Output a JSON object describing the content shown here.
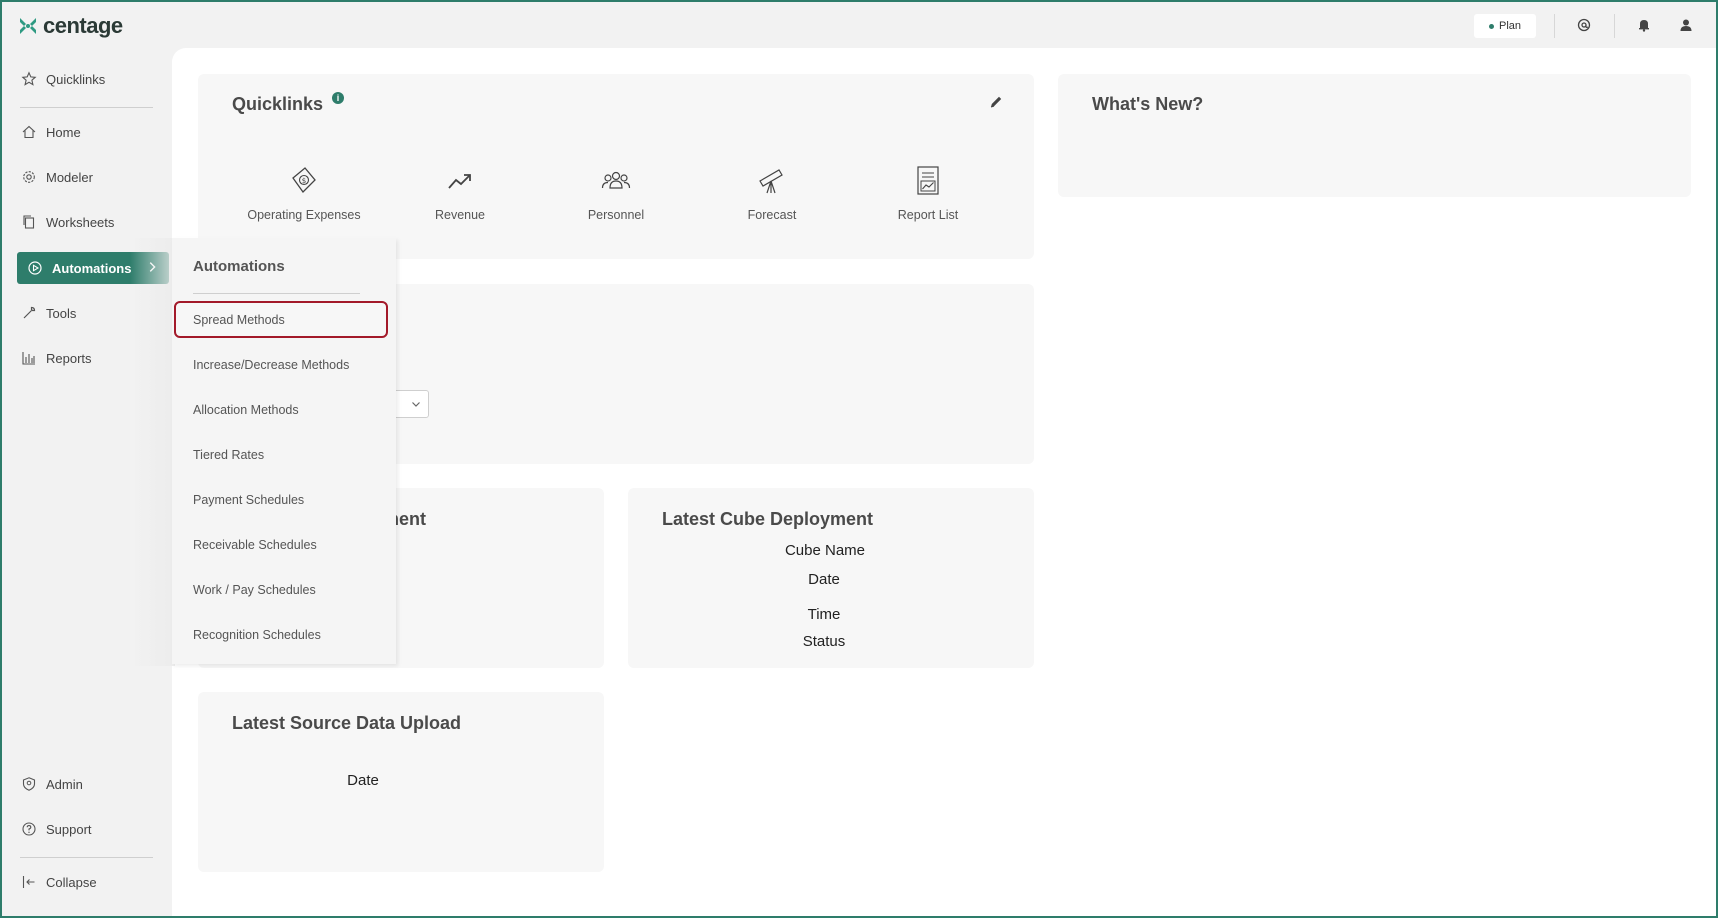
{
  "app": {
    "brand": "centage",
    "plan_label": "Plan",
    "brand_color": "#2e7d6b",
    "highlight_color": "#a31a2a"
  },
  "sidebar": {
    "items": [
      {
        "label": "Quicklinks",
        "icon": "star-icon"
      },
      {
        "label": "Home",
        "icon": "home-icon"
      },
      {
        "label": "Modeler",
        "icon": "gear-icon"
      },
      {
        "label": "Worksheets",
        "icon": "copy-icon"
      },
      {
        "label": "Automations",
        "icon": "play-circle-icon"
      },
      {
        "label": "Tools",
        "icon": "wrench-icon"
      },
      {
        "label": "Reports",
        "icon": "bar-chart-icon"
      }
    ],
    "bottom_items": [
      {
        "label": "Admin",
        "icon": "shield-icon"
      },
      {
        "label": "Support",
        "icon": "help-icon"
      },
      {
        "label": "Collapse",
        "icon": "collapse-icon"
      }
    ]
  },
  "quicklinks": {
    "title": "Quicklinks",
    "items": [
      {
        "label": "Operating Expenses",
        "icon": "money-icon"
      },
      {
        "label": "Revenue",
        "icon": "trend-up-icon"
      },
      {
        "label": "Personnel",
        "icon": "people-icon"
      },
      {
        "label": "Forecast",
        "icon": "telescope-icon"
      },
      {
        "label": "Report List",
        "icon": "report-icon"
      }
    ]
  },
  "whats_new": {
    "title": "What's New?"
  },
  "deployment": {
    "title_partial": "ment",
    "value_partial": "e"
  },
  "cube_deployment": {
    "title": "Latest Cube Deployment",
    "fields": [
      "Cube Name",
      "Date",
      "Time",
      "Status"
    ]
  },
  "source_upload": {
    "title": "Latest Source Data Upload",
    "fields": [
      "Date"
    ]
  },
  "flyout": {
    "title": "Automations",
    "items": [
      "Spread Methods",
      "Increase/Decrease Methods",
      "Allocation Methods",
      "Tiered Rates",
      "Payment Schedules",
      "Receivable Schedules",
      "Work / Pay Schedules",
      "Recognition Schedules"
    ]
  }
}
